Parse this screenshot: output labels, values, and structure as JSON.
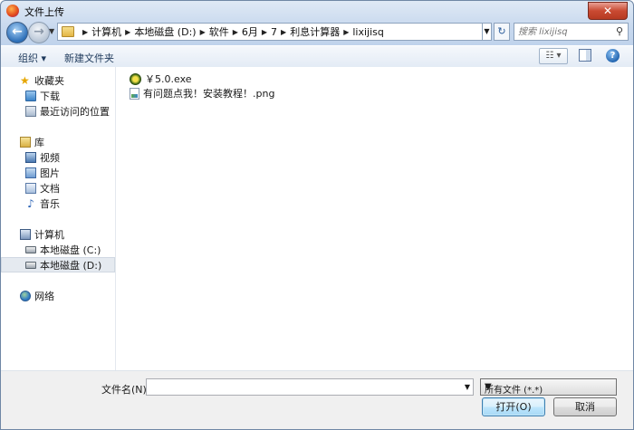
{
  "window": {
    "title": "文件上传",
    "close_symbol": "✕"
  },
  "address": {
    "crumbs": [
      "计算机",
      "本地磁盘 (D:)",
      "软件",
      "6月",
      "7",
      "利息计算器",
      "lixijisq"
    ],
    "search_placeholder": "搜索 lixijisq"
  },
  "toolbar": {
    "organize_label": "组织 ▾",
    "new_folder_label": "新建文件夹"
  },
  "nav": {
    "favorites": {
      "label": "收藏夹",
      "items": [
        "下载",
        "最近访问的位置"
      ]
    },
    "libraries": {
      "label": "库",
      "items": [
        "视频",
        "图片",
        "文档",
        "音乐"
      ]
    },
    "computer": {
      "label": "计算机",
      "items": [
        "本地磁盘 (C:)",
        "本地磁盘 (D:)"
      ]
    },
    "network": {
      "label": "网络"
    }
  },
  "files": [
    {
      "name": "￥5.0.exe",
      "icon": "exe-app-icon"
    },
    {
      "name": "有问题点我！安装教程！.png",
      "icon": "png-image-icon"
    }
  ],
  "bottom": {
    "filename_label": "文件名(N):",
    "filename_value": "",
    "filetype_value": "所有文件 (*.*)",
    "open_label": "打开(O)",
    "cancel_label": "取消"
  }
}
